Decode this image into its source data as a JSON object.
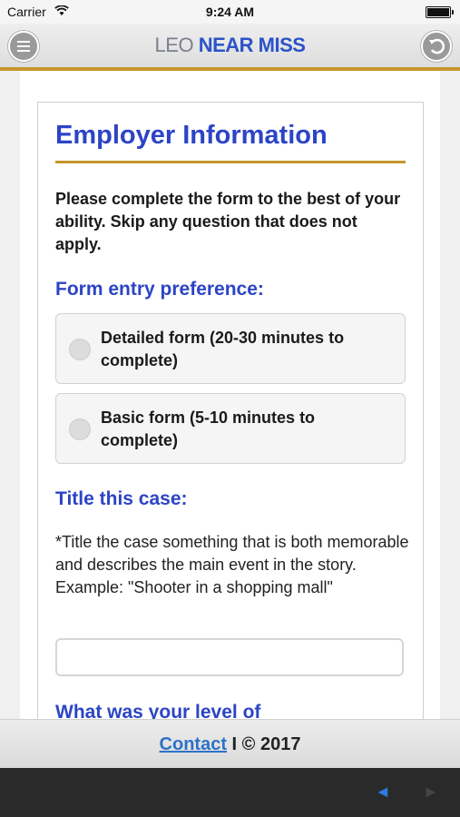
{
  "status_bar": {
    "carrier": "Carrier",
    "time": "9:24 AM"
  },
  "header": {
    "title_prefix": "LEO",
    "title_main": "NEAR MISS"
  },
  "form": {
    "section_title": "Employer Information",
    "intro": "Please complete the form to the best of your ability. Skip any question that does not apply.",
    "entry_preference": {
      "label": "Form entry preference:",
      "options": [
        {
          "label": "Detailed form (20-30 minutes to complete)",
          "selected": false
        },
        {
          "label": "Basic form (5-10 minutes to complete)",
          "selected": false
        }
      ]
    },
    "title_case": {
      "label": "Title this case:",
      "hint": "*Title the case something that is both memorable and describes the main event in the story. Example: \"Shooter in a shopping mall\"",
      "value": ""
    },
    "next_question_label": "What was your level of"
  },
  "footer": {
    "contact": "Contact",
    "copyright": "I © 2017"
  },
  "colors": {
    "accent_gold": "#c5962b",
    "heading_blue": "#2c44c6",
    "link_blue": "#2d72c8"
  },
  "icons": {
    "menu": "menu-icon",
    "back": "back-icon",
    "wifi": "wifi-icon",
    "battery": "battery-icon"
  }
}
